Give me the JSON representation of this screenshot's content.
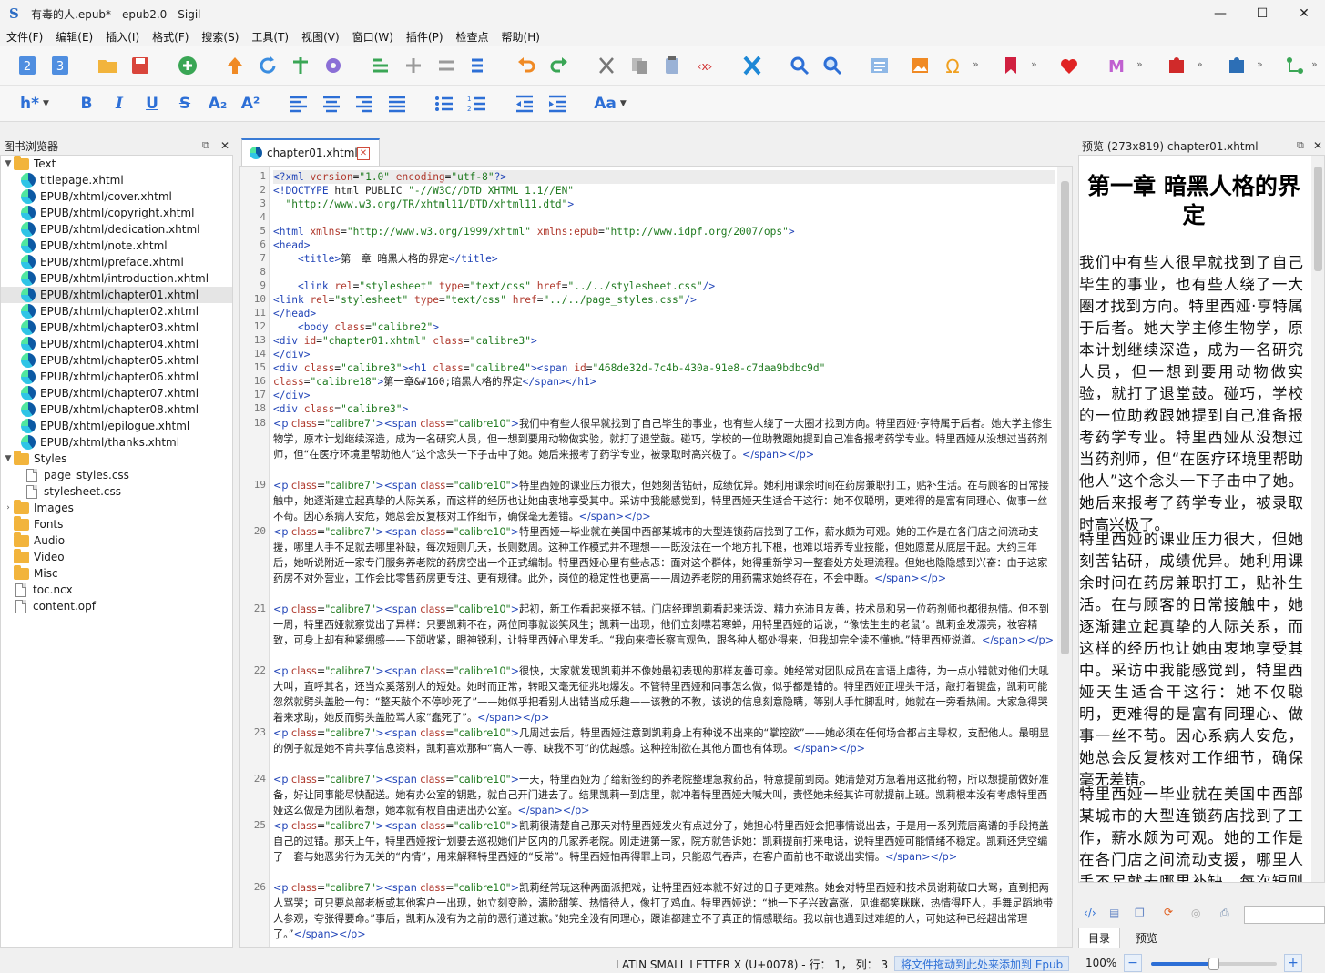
{
  "window": {
    "title": "有毒的人.epub* - epub2.0 - Sigil",
    "app_icon": "S"
  },
  "menu": [
    "文件(F)",
    "编辑(E)",
    "插入(I)",
    "格式(F)",
    "搜索(S)",
    "工具(T)",
    "视图(V)",
    "窗口(W)",
    "插件(P)",
    "检查点",
    "帮助(H)"
  ],
  "format_bar": {
    "heading": "h*",
    "bold": "B",
    "italic": "I",
    "underline": "U",
    "strike": "S",
    "sub": "A₂",
    "sup": "A²",
    "case": "Aa"
  },
  "book_browser": {
    "title": "图书浏览器",
    "text_folder": "Text",
    "text_files": [
      "titlepage.xhtml",
      "EPUB/xhtml/cover.xhtml",
      "EPUB/xhtml/copyright.xhtml",
      "EPUB/xhtml/dedication.xhtml",
      "EPUB/xhtml/note.xhtml",
      "EPUB/xhtml/preface.xhtml",
      "EPUB/xhtml/introduction.xhtml",
      "EPUB/xhtml/chapter01.xhtml",
      "EPUB/xhtml/chapter02.xhtml",
      "EPUB/xhtml/chapter03.xhtml",
      "EPUB/xhtml/chapter04.xhtml",
      "EPUB/xhtml/chapter05.xhtml",
      "EPUB/xhtml/chapter06.xhtml",
      "EPUB/xhtml/chapter07.xhtml",
      "EPUB/xhtml/chapter08.xhtml",
      "EPUB/xhtml/epilogue.xhtml",
      "EPUB/xhtml/thanks.xhtml"
    ],
    "styles_folder": "Styles",
    "style_files": [
      "page_styles.css",
      "stylesheet.css"
    ],
    "other_folders": [
      "Images",
      "Fonts",
      "Audio",
      "Video",
      "Misc"
    ],
    "root_files": [
      "toc.ncx",
      "content.opf"
    ]
  },
  "editor": {
    "tab_label": "chapter01.xhtml",
    "line_numbers": [
      "1",
      "2",
      "3",
      "4",
      "5",
      "6",
      "7",
      "8",
      "9",
      "10",
      "11",
      "12",
      "13",
      "14",
      "15",
      "16",
      "17",
      "18",
      "19",
      "20",
      "21",
      "22",
      "23",
      "24",
      "25",
      "26"
    ],
    "lines": [
      "<?xml version=\"1.0\" encoding=\"utf-8\"?>",
      "<!DOCTYPE html PUBLIC \"-//W3C//DTD XHTML 1.1//EN\"",
      "  \"http://www.w3.org/TR/xhtml11/DTD/xhtml11.dtd\">",
      "",
      "<html xmlns=\"http://www.w3.org/1999/xhtml\" xmlns:epub=\"http://www.idpf.org/2007/ops\">",
      "<head>",
      "    <title>第一章 暗黑人格的界定</title>",
      "",
      "    <link rel=\"stylesheet\" type=\"text/css\" href=\"../../stylesheet.css\"/>",
      "<link rel=\"stylesheet\" type=\"text/css\" href=\"../../page_styles.css\"/>",
      "</head>",
      "    <body class=\"calibre2\">",
      "<div id=\"chapter01.xhtml\" class=\"calibre3\">",
      "</div>",
      "<div class=\"calibre3\"><h1 class=\"calibre4\"><span id=\"468de32d-7c4b-430a-91e8-c7daa9bdbc9d\"",
      "class=\"calibre18\">第一章&#160;暗黑人格的界定</span></h1>",
      "</div>",
      "<div class=\"calibre3\">"
    ],
    "paragraphs": [
      "    <p class=\"calibre7\"><span class=\"calibre10\">我们中有些人很早就找到了自己毕生的事业，也有些人绕了一大圈才找到方向。特里西娅·亨特属于后者。她大学主修生物学，原本计划继续深造，成为一名研究人员，但一想到要用动物做实验，就打了退堂鼓。碰巧，学校的一位助教跟她提到自己准备报考药学专业。特里西娅从没想过当药剂师，但“在医疗环境里帮助他人”这个念头一下子击中了她。她后来报考了药学专业，被录取时高兴极了。</span></p>",
      "    <p class=\"calibre7\"><span class=\"calibre10\">特里西娅的课业压力很大，但她刻苦钻研，成绩优异。她利用课余时间在药房兼职打工，贴补生活。在与顾客的日常接触中，她逐渐建立起真挚的人际关系，而这样的经历也让她由衷地享受其中。采访中我能感觉到，特里西娅天生适合干这行：她不仅聪明，更难得的是富有同理心、做事一丝不苟。因心系病人安危，她总会反复核对工作细节，确保毫无差错。</span></p>",
      "    <p class=\"calibre7\"><span class=\"calibre10\">特里西娅一毕业就在美国中西部某城市的大型连锁药店找到了工作，薪水颇为可观。她的工作是在各门店之间流动支援，哪里人手不足就去哪里补缺，每次短则几天，长则数周。这种工作模式并不理想——既没法在一个地方扎下根，也难以培养专业技能，但她愿意从底层干起。大约三年后，她听说附近一家专门服务养老院的药房空出一个正式编制。特里西娅心里有些忐忑：面对这个群体，她得重新学习一整套处方处理流程。但她也隐隐感到兴奋：由于这家药房不对外营业，工作会比零售药房更专注、更有规律。此外，岗位的稳定性也更高——周边养老院的用药需求始终存在，不会中断。</span></p>",
      "    <p class=\"calibre7\"><span class=\"calibre10\">起初，新工作看起来挺不错。门店经理凯莉看起来活泼、精力充沛且友善，技术员和另一位药剂师也都很热情。但不到一周，特里西娅就察觉出了异样：只要凯莉不在，两位同事就谈笑风生；凯莉一出现，他们立刻噤若寒蝉，用特里西娅的话说，“像怯生生的老鼠”。凯莉金发漂亮，妆容精致，可身上却有种紧绷感——下颌收紧，眼神锐利，让特里西娅心里发毛。“我向来擅长察言观色，跟各种人都处得来，但我却完全读不懂她。”特里西娅说道。</span></p>",
      "    <p class=\"calibre7\"><span class=\"calibre10\">很快，大家就发现凯莉并不像她最初表现的那样友善可亲。她经常对团队成员在言语上虐待，为一点小错就对他们大吼大叫，直呼其名，还当众奚落别人的短处。她时而正常，转眼又毫无征兆地爆发。不管特里西娅和同事怎么做，似乎都是错的。特里西娅正埋头干活，敲打着键盘，凯莉可能忽然就劈头盖脸一句：“整天敲个不停吵死了”——她似乎把看别人出错当成乐趣——该教的不教，该说的信息刻意隐瞒，等别人手忙脚乱时，她就在一旁看热闹。大家急得哭着来求助，她反而劈头盖脸骂人家“蠢死了”。</span></p>",
      "    <p class=\"calibre7\"><span class=\"calibre10\">几周过去后，特里西娅注意到凯莉身上有种说不出来的“掌控欲”——她必须在任何场合都占主导权，支配他人。最明显的例子就是她不肯共享信息资料，凯莉喜欢那种“高人一等、缺我不可”的优越感。这种控制欲在其他方面也有体现。</span></p>",
      "    <p class=\"calibre7\"><span class=\"calibre10\">一天，特里西娅为了给新签约的养老院整理急救药品，特意提前到岗。她清楚对方急着用这批药物，所以想提前做好准备，好让同事能尽快配送。她有办公室的钥匙，就自己开门进去了。结果凯莉一到店里，就冲着特里西娅大喊大叫，责怪她未经其许可就提前上班。凯莉根本没有考虑特里西娅这么做是为团队着想，她本就有权自由进出办公室。</span></p>",
      "    <p class=\"calibre7\"><span class=\"calibre10\">凯莉很清楚自己那天对特里西娅发火有点过分了，她担心特里西娅会把事情说出去，于是用一系列荒唐离谱的手段掩盖自己的过错。那天上午，特里西娅按计划要去巡视她们片区内的几家养老院。刚走进第一家，院方就告诉她：凯莉提前打来电话，说特里西娅可能情绪不稳定。凯莉还凭空编了一套与她恶劣行为无关的“内情”，用来解释特里西娅的“反常”。特里西娅怕再得罪上司，只能忍气吞声，在客户面前也不敢说出实情。</span></p>",
      "    <p class=\"calibre7\"><span class=\"calibre10\">凯莉经常玩这种两面派把戏，让特里西娅本就不好过的日子更难熬。她会对特里西娅和技术员谢莉破口大骂，直到把两人骂哭；可只要总部老板或其他客户一出现，她立刻变脸，满脸甜笑、热情待人，像打了鸡血。特里西娅说：“她一下子兴致高涨，见谁都笑眯眯，热情得吓人，手舞足蹈地带人参观，夸张得要命。”事后，凯莉从没有为之前的恶行道过歉。”她完全没有同理心，跟谁都建立不了真正的情感联结。我以前也遇到过难缠的人，可她这种已经超出常理了。”</span></p>"
    ],
    "para_line_numbers": [
      "18",
      "19",
      "20",
      "21",
      "22",
      "23",
      "24",
      "25",
      "26"
    ],
    "para_tail": "</span></p>"
  },
  "preview": {
    "title": "预览 (273x819) chapter01.xhtml",
    "chapter_title": "第一章 暗黑人格的界定",
    "paragraphs": [
      "我们中有些人很早就找到了自己毕生的事业，也有些人绕了一大圈才找到方向。特里西娅·亨特属于后者。她大学主修生物学，原本计划继续深造，成为一名研究人员，但一想到要用动物做实验，就打了退堂鼓。碰巧，学校的一位助教跟她提到自己准备报考药学专业。特里西娅从没想过当药剂师，但“在医疗环境里帮助他人”这个念头一下子击中了她。她后来报考了药学专业，被录取时高兴极了。",
      "特里西娅的课业压力很大，但她刻苦钻研，成绩优异。她利用课余时间在药房兼职打工，贴补生活。在与顾客的日常接触中，她逐渐建立起真挚的人际关系，而这样的经历也让她由衷地享受其中。采访中我能感觉到，特里西娅天生适合干这行：她不仅聪明，更难得的是富有同理心、做事一丝不苟。因心系病人安危，她总会反复核对工作细节，确保毫无差错。",
      "特里西娅一毕业就在美国中西部某城市的大型连锁药店找到了工作，薪水颇为可观。她的工作是在各门店之间流动支援，哪里人手不足就去哪里补缺，每次短则几天，长则"
    ],
    "tabs": [
      "目录",
      "预览"
    ]
  },
  "status": {
    "char_info": "LATIN SMALL LETTER X (U+0078) - 行： 1， 列： 3",
    "drop_hint": "将文件拖动到此处来添加到 Epub",
    "zoom": "100%"
  },
  "colors": {
    "accent": "#2d6fd6",
    "tag": "#2346b8",
    "attr": "#b03a2e",
    "value": "#1f7a1f"
  }
}
